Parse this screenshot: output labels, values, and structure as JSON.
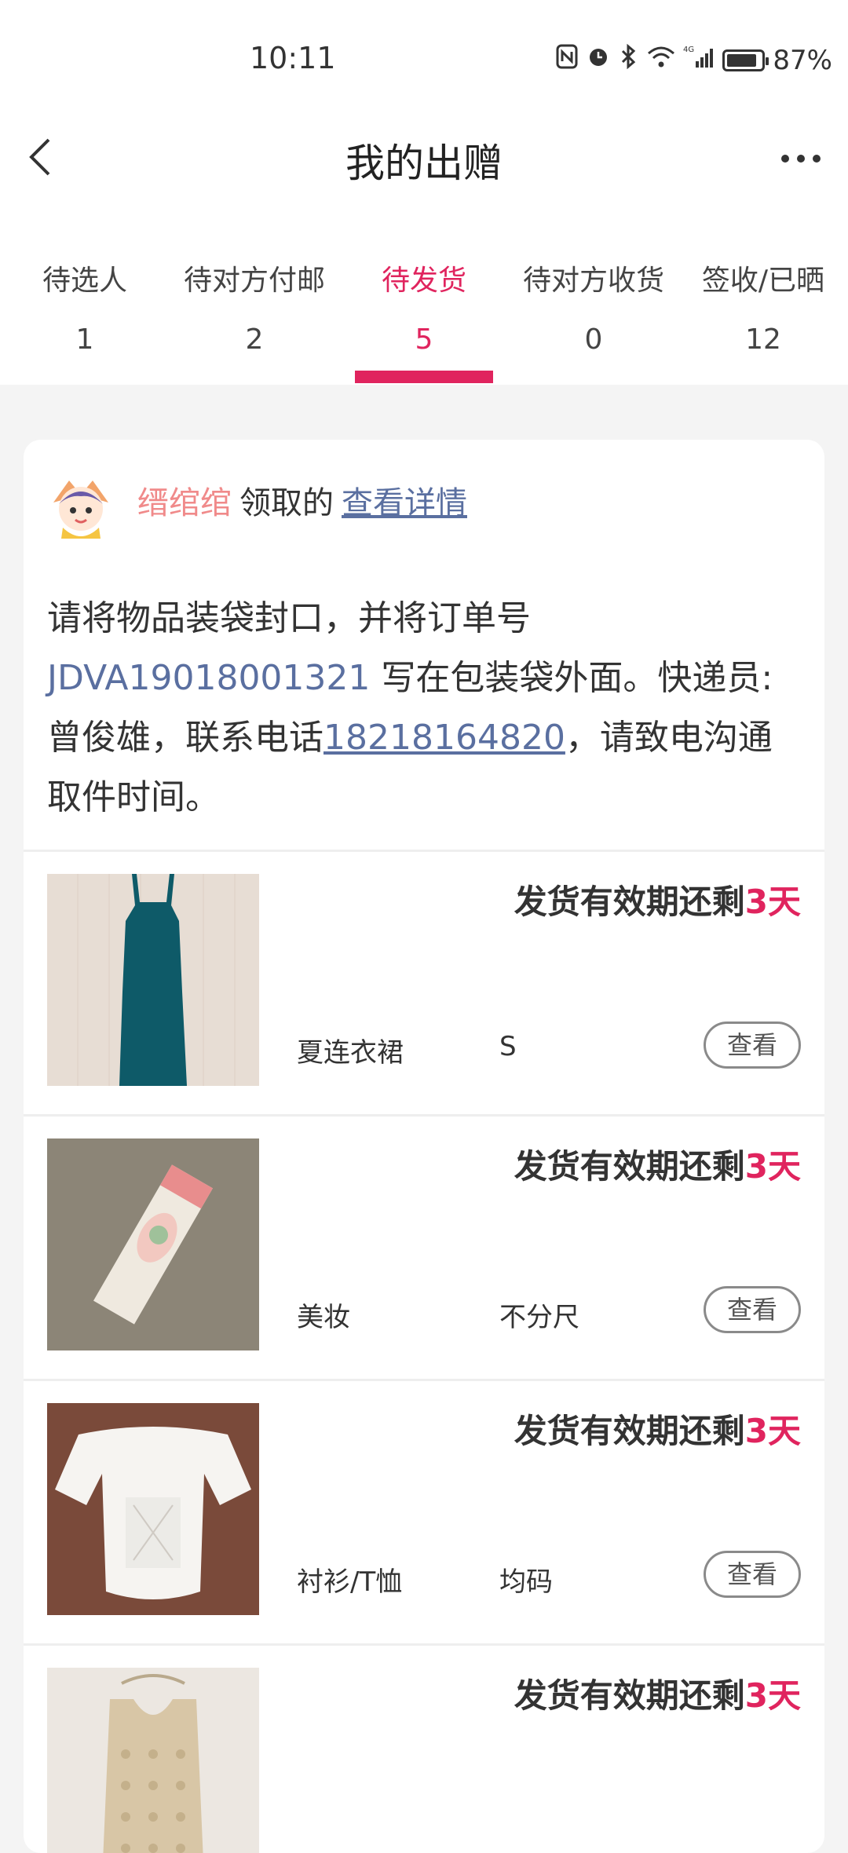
{
  "status_bar": {
    "time": "10:11",
    "battery": "87%",
    "battery_level": 0.87,
    "icons": [
      "nfc-icon",
      "alarm-icon",
      "bluetooth-icon",
      "wifi-icon",
      "signal-4g-icon",
      "battery-icon"
    ]
  },
  "header": {
    "title": "我的出赠",
    "back_icon": "back-arrow-icon",
    "more_icon": "more-dots-icon"
  },
  "tabs": [
    {
      "label": "待选人",
      "count": "1"
    },
    {
      "label": "待对方付邮",
      "count": "2"
    },
    {
      "label": "待发货",
      "count": "5",
      "active": true
    },
    {
      "label": "待对方收货",
      "count": "0"
    },
    {
      "label": "签收/已晒",
      "count": "12"
    }
  ],
  "card": {
    "user_name": "缙绾绾",
    "action": "领取的",
    "detail_link": "查看详情",
    "notice": {
      "part1": "请将物品装袋封口，并将订单号 ",
      "order_no": "JDVA19018001321",
      "part2": " 写在包装袋外面。快递员:曾俊雄，联系电话",
      "phone": "18218164820",
      "part3": "，请致电沟通取件时间。"
    }
  },
  "items": [
    {
      "deadline_text": "发货有效期还剩",
      "days": "3天",
      "category": "夏连衣裙",
      "size": "S",
      "button": "查看",
      "image": "teal-dress"
    },
    {
      "deadline_text": "发货有效期还剩",
      "days": "3天",
      "category": "美妆",
      "size": "不分尺",
      "button": "查看",
      "image": "cosmetic-box"
    },
    {
      "deadline_text": "发货有效期还剩",
      "days": "3天",
      "category": "衬衫/T恤",
      "size": "均码",
      "button": "查看",
      "image": "white-blouse"
    },
    {
      "deadline_text": "发货有效期还剩",
      "days": "3天",
      "category": "",
      "size": "",
      "button": "",
      "image": "knit-top"
    }
  ],
  "colors": {
    "accent": "#e0245e",
    "link": "#5a6fa0",
    "username": "#f08a8a"
  }
}
